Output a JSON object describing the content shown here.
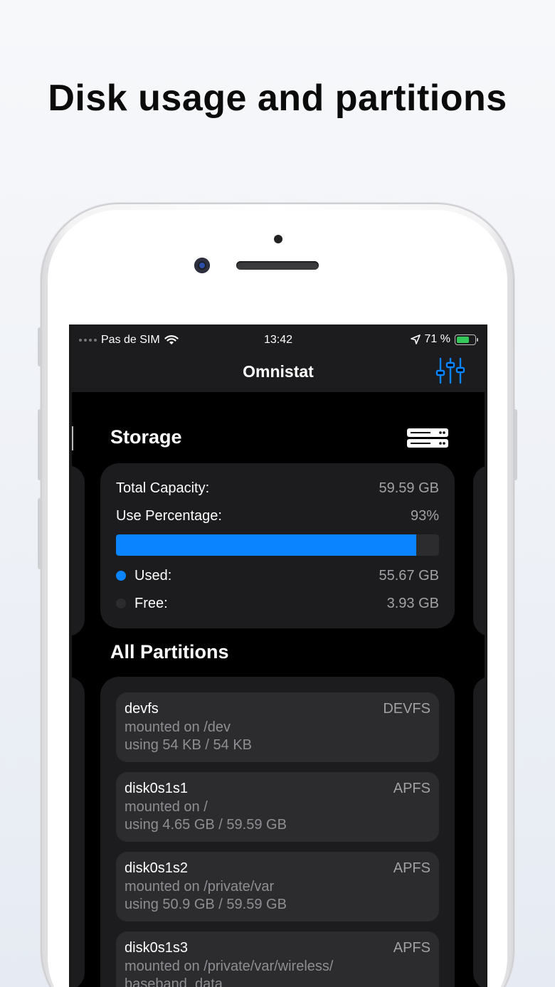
{
  "headline": "Disk usage and partitions",
  "status_bar": {
    "carrier": "Pas de SIM",
    "time": "13:42",
    "battery_text": "71 %",
    "battery_level": 0.71
  },
  "nav": {
    "title": "Omnistat",
    "filter_icon": "sliders-icon"
  },
  "storage": {
    "title": "Storage",
    "icon": "server-icon",
    "total_label": "Total Capacity:",
    "total_value": "59.59 GB",
    "percent_label": "Use Percentage:",
    "percent_value": "93%",
    "used_fraction": 0.93,
    "used_label": "Used:",
    "used_value": "55.67 GB",
    "free_label": "Free:",
    "free_value": "3.93 GB",
    "used_color": "#0a84ff",
    "free_color": "#2c2c2e"
  },
  "partitions": {
    "title": "All Partitions",
    "items": [
      {
        "name": "devfs",
        "fs": "DEVFS",
        "mount": "mounted on /dev",
        "usage": "using 54 KB / 54 KB"
      },
      {
        "name": "disk0s1s1",
        "fs": "APFS",
        "mount": "mounted on /",
        "usage": "using 4.65 GB / 59.59 GB"
      },
      {
        "name": "disk0s1s2",
        "fs": "APFS",
        "mount": "mounted on /private/var",
        "usage": "using 50.9 GB / 59.59 GB"
      },
      {
        "name": "disk0s1s3",
        "fs": "APFS",
        "mount": "mounted on /private/var/wireless/",
        "usage": "baseband_data"
      }
    ]
  },
  "colors": {
    "accent": "#0a84ff",
    "background": "#000000",
    "card": "#1c1c1e",
    "inner_card": "#2c2c2e"
  }
}
